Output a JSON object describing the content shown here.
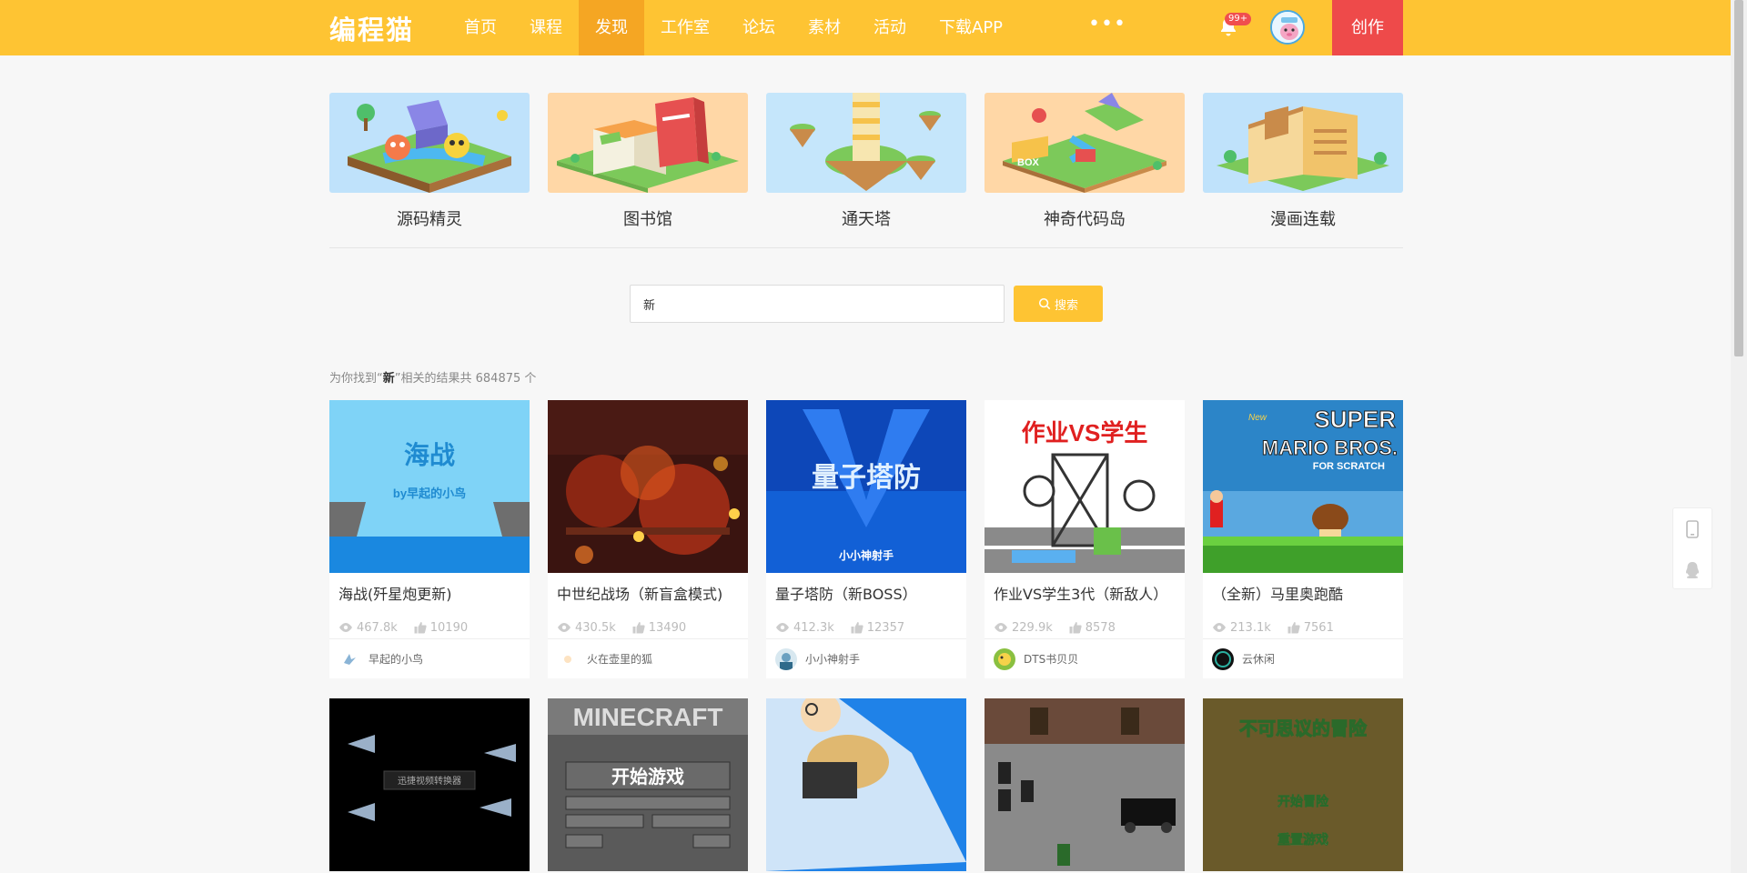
{
  "header": {
    "logo": "编程猫",
    "nav": [
      "首页",
      "课程",
      "发现",
      "工作室",
      "论坛",
      "素材",
      "活动",
      "下载APP"
    ],
    "active_nav": "发现",
    "more": "•••",
    "notification_badge": "99+",
    "create_label": "创作",
    "accent_color": "#fec433",
    "create_color": "#ee4a4a"
  },
  "categories": [
    "源码精灵",
    "图书馆",
    "通天塔",
    "神奇代码岛",
    "漫画连载"
  ],
  "search": {
    "value": "新",
    "button_label": "搜索"
  },
  "result": {
    "prefix": "为你找到“",
    "keyword": "新",
    "suffix": "”相关的结果共 684875 个"
  },
  "works": [
    {
      "title": "海战(歼星炮更新)",
      "views": "467.8k",
      "likes": "10190",
      "author": "早起的小鸟"
    },
    {
      "title": "中世纪战场（新盲盒模式)",
      "views": "430.5k",
      "likes": "13490",
      "author": "火在壶里的狐"
    },
    {
      "title": "量子塔防（新BOSS）",
      "views": "412.3k",
      "likes": "12357",
      "author": "小小神射手"
    },
    {
      "title": "作业VS学生3代（新敌人）",
      "views": "229.9k",
      "likes": "8578",
      "author": "DTS书贝贝"
    },
    {
      "title": "（全新）马里奥跑酷",
      "views": "213.1k",
      "likes": "7561",
      "author": "云休闲"
    }
  ],
  "thumb_texts": {
    "haizhan": "海战",
    "haizhan_sub": "by早起的小鸟",
    "liangzi": "量子塔防",
    "liangzi_sub": "小小神射手",
    "zuoye": "作业VS学生",
    "mario1": "SUPER",
    "mario2": "MARIO BROS.",
    "mario3": "FOR SCRATCH",
    "mario_new": "New",
    "converter": "迅捷视频转换器",
    "minecraft": "MINECRAFT",
    "start_game": "开始游戏",
    "bukesiyi": "不可思议的冒险",
    "start_adventure": "开始冒险",
    "replay": "重置游戏"
  }
}
